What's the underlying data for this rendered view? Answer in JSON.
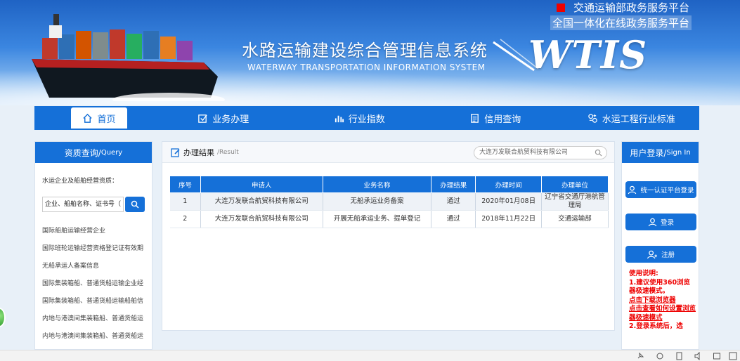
{
  "header": {
    "title": "水路运输建设综合管理信息系统",
    "subtitle": "WATERWAY TRANSPORTATION INFORMATION SYSTEM",
    "logo": "WTIS",
    "top_link_1": "交通运输部政务服务平台",
    "top_link_2": "全国一体化在线政务服务平台"
  },
  "nav": {
    "items": [
      {
        "label": "首页",
        "icon": "home-icon"
      },
      {
        "label": "业务办理",
        "icon": "check-square-icon"
      },
      {
        "label": "行业指数",
        "icon": "bar-chart-icon"
      },
      {
        "label": "信用查询",
        "icon": "document-icon"
      },
      {
        "label": "水运工程行业标准",
        "icon": "settings-icon"
      }
    ]
  },
  "left_panel": {
    "title": "资质查询/",
    "title_en": "Query",
    "intro": "水运企业及船舶经营资质：",
    "search_placeholder": "企业、船舶名称、证书号（",
    "links": [
      "国际船舶运输经营企业",
      "国际班轮运输经营资格登记证有效期",
      "无船承运人备案信息",
      "国际集装箱船、普通货船运输企业经",
      "国际集装箱船、普通货船运输船舶信",
      "内地与港澳间集装箱船、普通货船运",
      "内地与港澳间集装箱船、普通货船运"
    ]
  },
  "result": {
    "title": "办理结果",
    "title_en": "/Result",
    "search_value": "大连万发联合航贸科技有限公司",
    "columns": [
      "序号",
      "申请人",
      "业务名称",
      "办理结果",
      "办理时间",
      "办理单位"
    ],
    "rows": [
      [
        "1",
        "大连万发联合航贸科技有限公司",
        "无船承运业务备案",
        "通过",
        "2020年01月08日",
        "辽宁省交通厅港航管理局"
      ],
      [
        "2",
        "大连万发联合航贸科技有限公司",
        "开展无船承运业务、提单登记",
        "通过",
        "2018年11月22日",
        "交通运输部"
      ]
    ]
  },
  "right_panel": {
    "title": "用户登录/",
    "title_en": "Sign In",
    "btn_unified": "统一认证平台登录",
    "btn_login": "登录",
    "btn_register": "注册",
    "usage_title": "使用说明:",
    "usage_1": "1.建议使用360浏览器极速模式。",
    "usage_link_1": "点击下载浏览器",
    "usage_link_2": "点击查看如何设置浏览器极速模式",
    "usage_2": "2.登录系统后，选"
  },
  "colors": {
    "primary": "#1570d8",
    "warning": "#e00000"
  }
}
